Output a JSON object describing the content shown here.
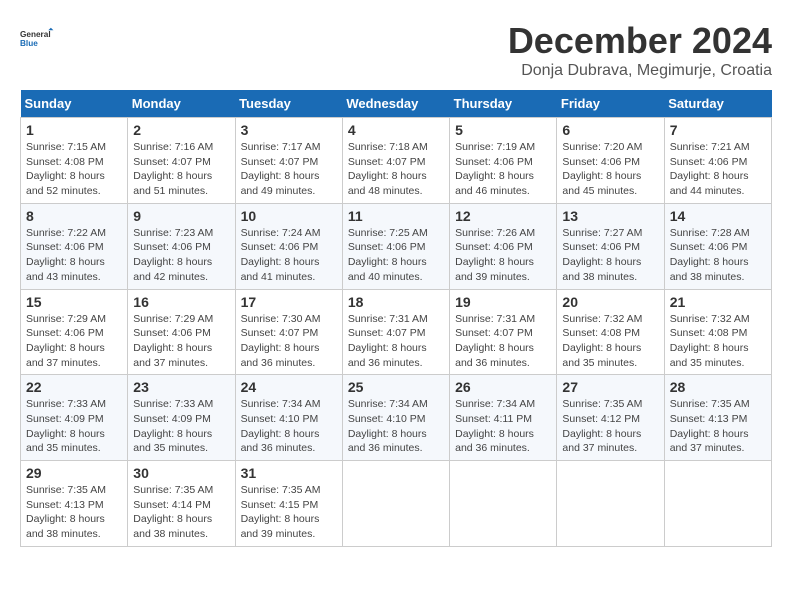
{
  "header": {
    "logo_line1": "General",
    "logo_line2": "Blue",
    "month": "December 2024",
    "location": "Donja Dubrava, Megimurje, Croatia"
  },
  "days_of_week": [
    "Sunday",
    "Monday",
    "Tuesday",
    "Wednesday",
    "Thursday",
    "Friday",
    "Saturday"
  ],
  "weeks": [
    [
      {
        "day": 1,
        "sunrise": "7:15 AM",
        "sunset": "4:08 PM",
        "daylight": "8 hours and 52 minutes."
      },
      {
        "day": 2,
        "sunrise": "7:16 AM",
        "sunset": "4:07 PM",
        "daylight": "8 hours and 51 minutes."
      },
      {
        "day": 3,
        "sunrise": "7:17 AM",
        "sunset": "4:07 PM",
        "daylight": "8 hours and 49 minutes."
      },
      {
        "day": 4,
        "sunrise": "7:18 AM",
        "sunset": "4:07 PM",
        "daylight": "8 hours and 48 minutes."
      },
      {
        "day": 5,
        "sunrise": "7:19 AM",
        "sunset": "4:06 PM",
        "daylight": "8 hours and 46 minutes."
      },
      {
        "day": 6,
        "sunrise": "7:20 AM",
        "sunset": "4:06 PM",
        "daylight": "8 hours and 45 minutes."
      },
      {
        "day": 7,
        "sunrise": "7:21 AM",
        "sunset": "4:06 PM",
        "daylight": "8 hours and 44 minutes."
      }
    ],
    [
      {
        "day": 8,
        "sunrise": "7:22 AM",
        "sunset": "4:06 PM",
        "daylight": "8 hours and 43 minutes."
      },
      {
        "day": 9,
        "sunrise": "7:23 AM",
        "sunset": "4:06 PM",
        "daylight": "8 hours and 42 minutes."
      },
      {
        "day": 10,
        "sunrise": "7:24 AM",
        "sunset": "4:06 PM",
        "daylight": "8 hours and 41 minutes."
      },
      {
        "day": 11,
        "sunrise": "7:25 AM",
        "sunset": "4:06 PM",
        "daylight": "8 hours and 40 minutes."
      },
      {
        "day": 12,
        "sunrise": "7:26 AM",
        "sunset": "4:06 PM",
        "daylight": "8 hours and 39 minutes."
      },
      {
        "day": 13,
        "sunrise": "7:27 AM",
        "sunset": "4:06 PM",
        "daylight": "8 hours and 38 minutes."
      },
      {
        "day": 14,
        "sunrise": "7:28 AM",
        "sunset": "4:06 PM",
        "daylight": "8 hours and 38 minutes."
      }
    ],
    [
      {
        "day": 15,
        "sunrise": "7:29 AM",
        "sunset": "4:06 PM",
        "daylight": "8 hours and 37 minutes."
      },
      {
        "day": 16,
        "sunrise": "7:29 AM",
        "sunset": "4:06 PM",
        "daylight": "8 hours and 37 minutes."
      },
      {
        "day": 17,
        "sunrise": "7:30 AM",
        "sunset": "4:07 PM",
        "daylight": "8 hours and 36 minutes."
      },
      {
        "day": 18,
        "sunrise": "7:31 AM",
        "sunset": "4:07 PM",
        "daylight": "8 hours and 36 minutes."
      },
      {
        "day": 19,
        "sunrise": "7:31 AM",
        "sunset": "4:07 PM",
        "daylight": "8 hours and 36 minutes."
      },
      {
        "day": 20,
        "sunrise": "7:32 AM",
        "sunset": "4:08 PM",
        "daylight": "8 hours and 35 minutes."
      },
      {
        "day": 21,
        "sunrise": "7:32 AM",
        "sunset": "4:08 PM",
        "daylight": "8 hours and 35 minutes."
      }
    ],
    [
      {
        "day": 22,
        "sunrise": "7:33 AM",
        "sunset": "4:09 PM",
        "daylight": "8 hours and 35 minutes."
      },
      {
        "day": 23,
        "sunrise": "7:33 AM",
        "sunset": "4:09 PM",
        "daylight": "8 hours and 35 minutes."
      },
      {
        "day": 24,
        "sunrise": "7:34 AM",
        "sunset": "4:10 PM",
        "daylight": "8 hours and 36 minutes."
      },
      {
        "day": 25,
        "sunrise": "7:34 AM",
        "sunset": "4:10 PM",
        "daylight": "8 hours and 36 minutes."
      },
      {
        "day": 26,
        "sunrise": "7:34 AM",
        "sunset": "4:11 PM",
        "daylight": "8 hours and 36 minutes."
      },
      {
        "day": 27,
        "sunrise": "7:35 AM",
        "sunset": "4:12 PM",
        "daylight": "8 hours and 37 minutes."
      },
      {
        "day": 28,
        "sunrise": "7:35 AM",
        "sunset": "4:13 PM",
        "daylight": "8 hours and 37 minutes."
      }
    ],
    [
      {
        "day": 29,
        "sunrise": "7:35 AM",
        "sunset": "4:13 PM",
        "daylight": "8 hours and 38 minutes."
      },
      {
        "day": 30,
        "sunrise": "7:35 AM",
        "sunset": "4:14 PM",
        "daylight": "8 hours and 38 minutes."
      },
      {
        "day": 31,
        "sunrise": "7:35 AM",
        "sunset": "4:15 PM",
        "daylight": "8 hours and 39 minutes."
      },
      null,
      null,
      null,
      null
    ]
  ]
}
